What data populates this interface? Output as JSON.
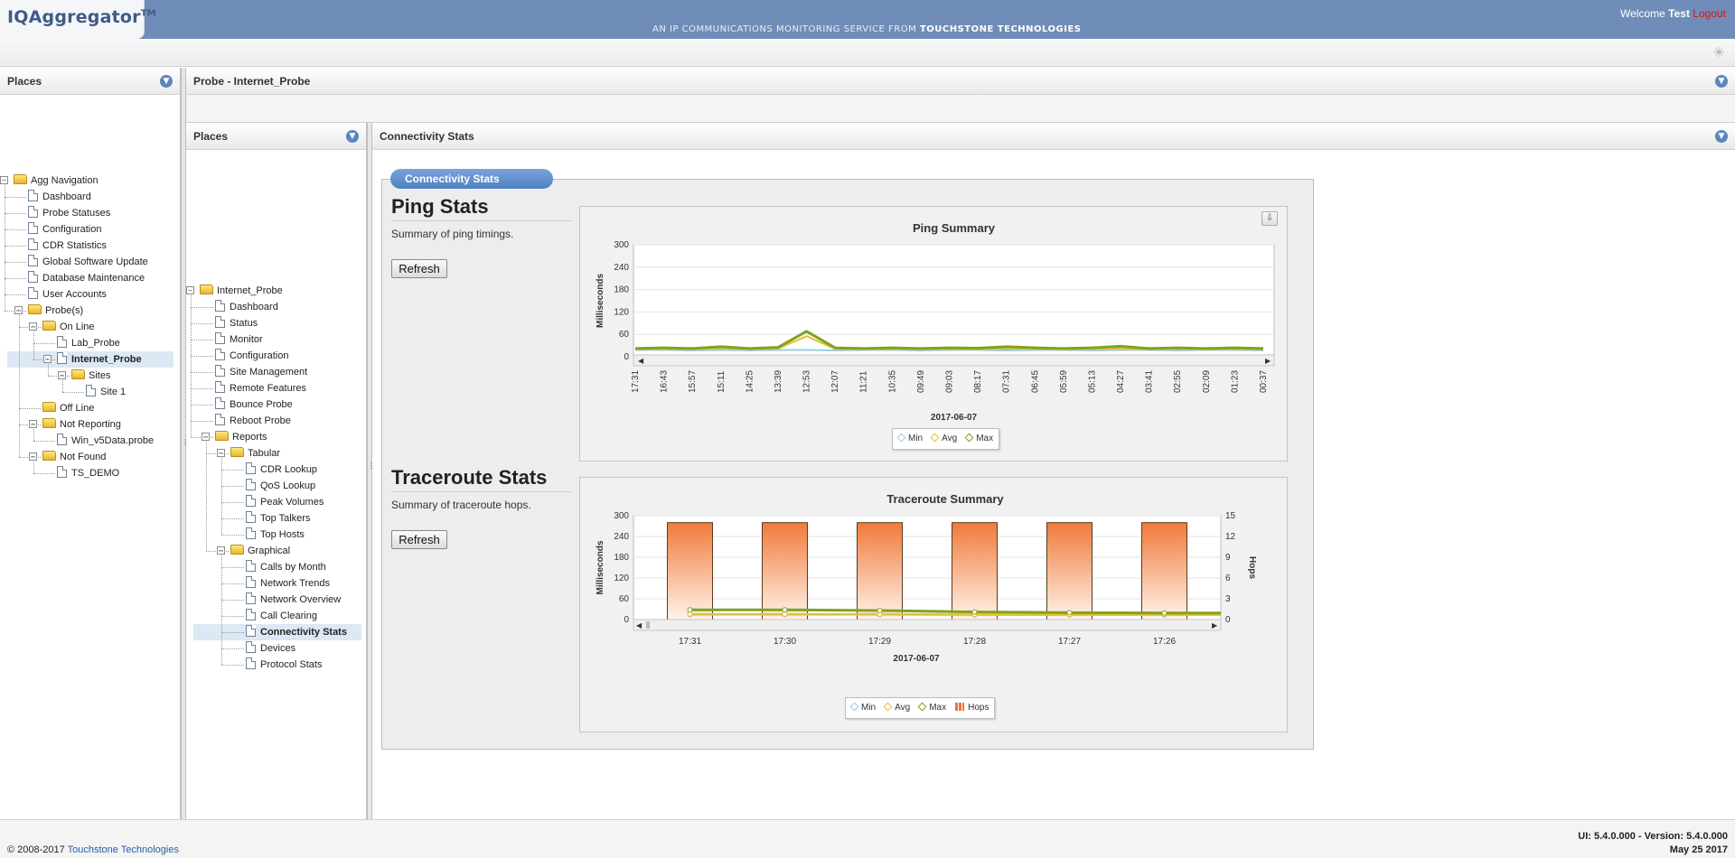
{
  "header": {
    "logo": "IQAggregator",
    "logo_tm": "TM",
    "tagline_pre": "AN IP COMMUNICATIONS MONITORING SERVICE FROM",
    "tagline_brand": "TOUCHSTONE TECHNOLOGIES",
    "welcome_text": "Welcome",
    "user": "Test",
    "logout": "Logout"
  },
  "left_panel": {
    "title": "Places",
    "tree": [
      {
        "label": "Agg Navigation",
        "type": "folder",
        "depth": 0,
        "expander": "-"
      },
      {
        "label": "Dashboard",
        "type": "file",
        "depth": 1
      },
      {
        "label": "Probe Statuses",
        "type": "file",
        "depth": 1
      },
      {
        "label": "Configuration",
        "type": "file",
        "depth": 1
      },
      {
        "label": "CDR Statistics",
        "type": "file",
        "depth": 1
      },
      {
        "label": "Global Software Update",
        "type": "file",
        "depth": 1
      },
      {
        "label": "Database Maintenance",
        "type": "file",
        "depth": 1
      },
      {
        "label": "User Accounts",
        "type": "file",
        "depth": 1
      },
      {
        "label": "Probe(s)",
        "type": "folder",
        "depth": 1,
        "expander": "-"
      },
      {
        "label": "On Line",
        "type": "folder",
        "depth": 2,
        "expander": "-"
      },
      {
        "label": "Lab_Probe",
        "type": "file",
        "depth": 3
      },
      {
        "label": "Internet_Probe",
        "type": "file",
        "depth": 3,
        "expander": "-",
        "selected": true
      },
      {
        "label": "Sites",
        "type": "folder",
        "depth": 4,
        "expander": "-"
      },
      {
        "label": "Site 1",
        "type": "file",
        "depth": 5
      },
      {
        "label": "Off Line",
        "type": "folder",
        "depth": 2
      },
      {
        "label": "Not Reporting",
        "type": "folder",
        "depth": 2,
        "expander": "-"
      },
      {
        "label": "Win_v5Data.probe",
        "type": "file",
        "depth": 3
      },
      {
        "label": "Not Found",
        "type": "folder",
        "depth": 2,
        "expander": "-"
      },
      {
        "label": "TS_DEMO",
        "type": "file",
        "depth": 3
      }
    ]
  },
  "probe_panel": {
    "title": "Probe - Internet_Probe"
  },
  "probe_places": {
    "title": "Places",
    "tree": [
      {
        "label": "Internet_Probe",
        "type": "folder",
        "depth": 0,
        "expander": "-"
      },
      {
        "label": "Dashboard",
        "type": "file",
        "depth": 1
      },
      {
        "label": "Status",
        "type": "file",
        "depth": 1
      },
      {
        "label": "Monitor",
        "type": "file",
        "depth": 1
      },
      {
        "label": "Configuration",
        "type": "file",
        "depth": 1
      },
      {
        "label": "Site Management",
        "type": "file",
        "depth": 1
      },
      {
        "label": "Remote Features",
        "type": "file",
        "depth": 1
      },
      {
        "label": "Bounce Probe",
        "type": "file",
        "depth": 1
      },
      {
        "label": "Reboot Probe",
        "type": "file",
        "depth": 1
      },
      {
        "label": "Reports",
        "type": "folder",
        "depth": 1,
        "expander": "-"
      },
      {
        "label": "Tabular",
        "type": "folder",
        "depth": 2,
        "expander": "-"
      },
      {
        "label": "CDR Lookup",
        "type": "file",
        "depth": 3
      },
      {
        "label": "QoS Lookup",
        "type": "file",
        "depth": 3
      },
      {
        "label": "Peak Volumes",
        "type": "file",
        "depth": 3
      },
      {
        "label": "Top Talkers",
        "type": "file",
        "depth": 3
      },
      {
        "label": "Top Hosts",
        "type": "file",
        "depth": 3
      },
      {
        "label": "Graphical",
        "type": "folder",
        "depth": 2,
        "expander": "-"
      },
      {
        "label": "Calls by Month",
        "type": "file",
        "depth": 3
      },
      {
        "label": "Network Trends",
        "type": "file",
        "depth": 3
      },
      {
        "label": "Network Overview",
        "type": "file",
        "depth": 3
      },
      {
        "label": "Call Clearing",
        "type": "file",
        "depth": 3
      },
      {
        "label": "Connectivity Stats",
        "type": "file",
        "depth": 3,
        "selected": true
      },
      {
        "label": "Devices",
        "type": "file",
        "depth": 3
      },
      {
        "label": "Protocol Stats",
        "type": "file",
        "depth": 3
      }
    ]
  },
  "conn_panel": {
    "title": "Connectivity Stats",
    "legend_label": "Connectivity Stats"
  },
  "ping": {
    "title": "Ping Stats",
    "description": "Summary of ping timings.",
    "refresh": "Refresh"
  },
  "traceroute": {
    "title": "Traceroute Stats",
    "description": "Summary of traceroute hops.",
    "refresh": "Refresh"
  },
  "colors": {
    "min": "#9ccbe8",
    "avg": "#e8c12a",
    "max": "#7fa320",
    "hops": "#e8743b"
  },
  "chart_data": [
    {
      "type": "line",
      "title": "Ping Summary",
      "ylabel": "Milliseconds",
      "xlabel": "2017-06-07",
      "ylim": [
        0,
        300
      ],
      "yticks": [
        0,
        60,
        120,
        180,
        240,
        300
      ],
      "categories": [
        "17:31",
        "16:43",
        "15:57",
        "15:11",
        "14:25",
        "13:39",
        "12:53",
        "12:07",
        "11:21",
        "10:35",
        "09:49",
        "09:03",
        "08:17",
        "07:31",
        "06:45",
        "05:59",
        "05:13",
        "04:27",
        "03:41",
        "02:55",
        "02:09",
        "01:23",
        "00:37"
      ],
      "legend": [
        "Min",
        "Avg",
        "Max"
      ],
      "series": [
        {
          "name": "Min",
          "values": [
            18,
            18,
            17,
            18,
            17,
            18,
            18,
            17,
            18,
            18,
            17,
            18,
            18,
            17,
            18,
            18,
            17,
            18,
            18,
            17,
            18,
            18,
            17
          ]
        },
        {
          "name": "Avg",
          "values": [
            20,
            21,
            20,
            22,
            20,
            22,
            55,
            21,
            20,
            21,
            20,
            21,
            20,
            22,
            21,
            20,
            21,
            22,
            20,
            21,
            20,
            21,
            20
          ]
        },
        {
          "name": "Max",
          "values": [
            22,
            24,
            22,
            27,
            22,
            25,
            68,
            24,
            22,
            24,
            22,
            24,
            23,
            27,
            24,
            22,
            24,
            28,
            22,
            24,
            22,
            24,
            22
          ]
        }
      ]
    },
    {
      "type": "bar",
      "title": "Traceroute Summary",
      "ylabel": "Milliseconds",
      "y2label": "Hops",
      "xlabel": "2017-06-07",
      "ylim": [
        0,
        300
      ],
      "yticks": [
        0,
        60,
        120,
        180,
        240,
        300
      ],
      "y2lim": [
        0,
        15
      ],
      "y2ticks": [
        0,
        3,
        6,
        9,
        12,
        15
      ],
      "categories": [
        "17:31",
        "17:30",
        "17:29",
        "17:28",
        "17:27",
        "17:26"
      ],
      "legend": [
        "Min",
        "Avg",
        "Max",
        "Hops"
      ],
      "series": [
        {
          "name": "Hops",
          "axis": "right",
          "values": [
            14,
            14,
            14,
            14,
            14,
            14
          ]
        },
        {
          "name": "Min",
          "values": [
            14,
            14,
            14,
            13,
            13,
            13
          ]
        },
        {
          "name": "Avg",
          "values": [
            16,
            16,
            16,
            15,
            15,
            15
          ]
        },
        {
          "name": "Max",
          "values": [
            28,
            28,
            26,
            22,
            20,
            19
          ]
        }
      ]
    }
  ],
  "footer": {
    "copyright": "© 2008-2017",
    "company": "Touchstone Technologies",
    "version": "UI: 5.4.0.000 - Version: 5.4.0.000",
    "date": "May 25 2017"
  }
}
